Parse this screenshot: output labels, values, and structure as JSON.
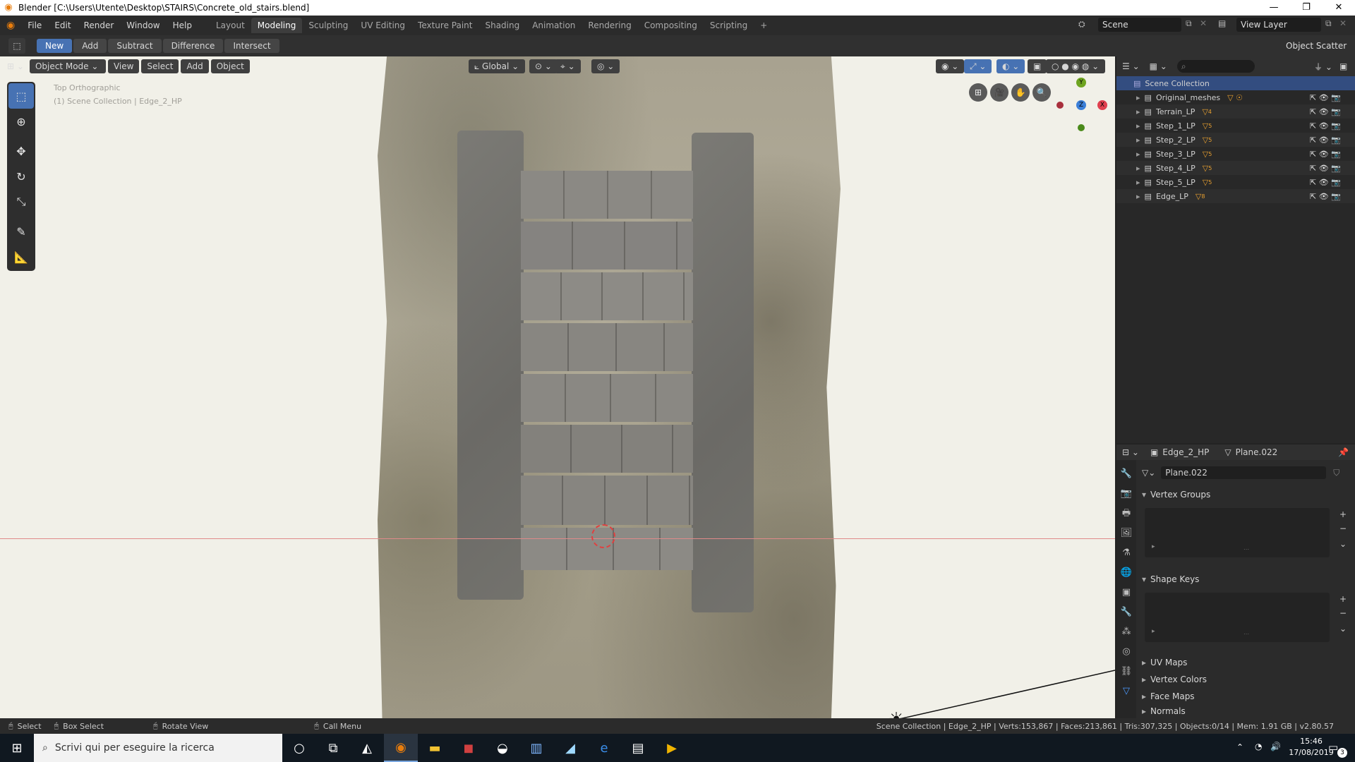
{
  "titlebar": {
    "title": "Blender [C:\\Users\\Utente\\Desktop\\STAIRS\\Concrete_old_stairs.blend]",
    "minimize": "—",
    "maximize": "❐",
    "close": "✕"
  },
  "menu": {
    "items": [
      "File",
      "Edit",
      "Render",
      "Window",
      "Help"
    ],
    "workspaces": [
      "Layout",
      "Modeling",
      "Sculpting",
      "UV Editing",
      "Texture Paint",
      "Shading",
      "Animation",
      "Rendering",
      "Compositing",
      "Scripting"
    ],
    "active_workspace": "Modeling",
    "add_tab": "+",
    "scene_label": "Scene",
    "view_layer_label": "View Layer"
  },
  "toolheader": {
    "buttons": [
      "New",
      "Add",
      "Subtract",
      "Difference",
      "Intersect"
    ],
    "active": "New",
    "right_label": "Object Scatter"
  },
  "viewport": {
    "mode": "Object Mode",
    "menus": [
      "View",
      "Select",
      "Add",
      "Object"
    ],
    "transform_orientation": "Global",
    "overlay_line1": "Top Orthographic",
    "overlay_line2": "(1) Scene Collection | Edge_2_HP",
    "gizmo": {
      "y": "Y",
      "z": "Z",
      "x": "X"
    }
  },
  "outliner": {
    "search_placeholder": "",
    "root": "Scene Collection",
    "items": [
      {
        "name": "Original_meshes",
        "badge": ""
      },
      {
        "name": "Terrain_LP",
        "badge": "4"
      },
      {
        "name": "Step_1_LP",
        "badge": "5"
      },
      {
        "name": "Step_2_LP",
        "badge": "5"
      },
      {
        "name": "Step_3_LP",
        "badge": "5"
      },
      {
        "name": "Step_4_LP",
        "badge": "5"
      },
      {
        "name": "Step_5_LP",
        "badge": "5"
      },
      {
        "name": "Edge_LP",
        "badge": "8"
      }
    ]
  },
  "properties": {
    "object_name": "Edge_2_HP",
    "mesh_name": "Plane.022",
    "data_field": "Plane.022",
    "sections": {
      "vertex_groups": "Vertex Groups",
      "shape_keys": "Shape Keys",
      "uv_maps": "UV Maps",
      "vertex_colors": "Vertex Colors",
      "face_maps": "Face Maps",
      "normals": "Normals"
    }
  },
  "statusbar": {
    "select": "Select",
    "box_select": "Box Select",
    "rotate_view": "Rotate View",
    "call_menu": "Call Menu",
    "stats": "Scene Collection | Edge_2_HP | Verts:153,867 | Faces:213,861 | Tris:307,325 | Objects:0/14 | Mem: 1.91 GB | v2.80.57"
  },
  "taskbar": {
    "search_text": "Scrivi qui per eseguire la ricerca",
    "time": "15:46",
    "date": "17/08/2019",
    "notification_count": "3"
  },
  "colors": {
    "accent": "#4772b3",
    "selected_row": "#334d80",
    "viewport_bg": "#f1f0e8",
    "axis_x": "#e0404f",
    "axis_y": "#6ea420",
    "axis_z": "#3b7fd8"
  }
}
